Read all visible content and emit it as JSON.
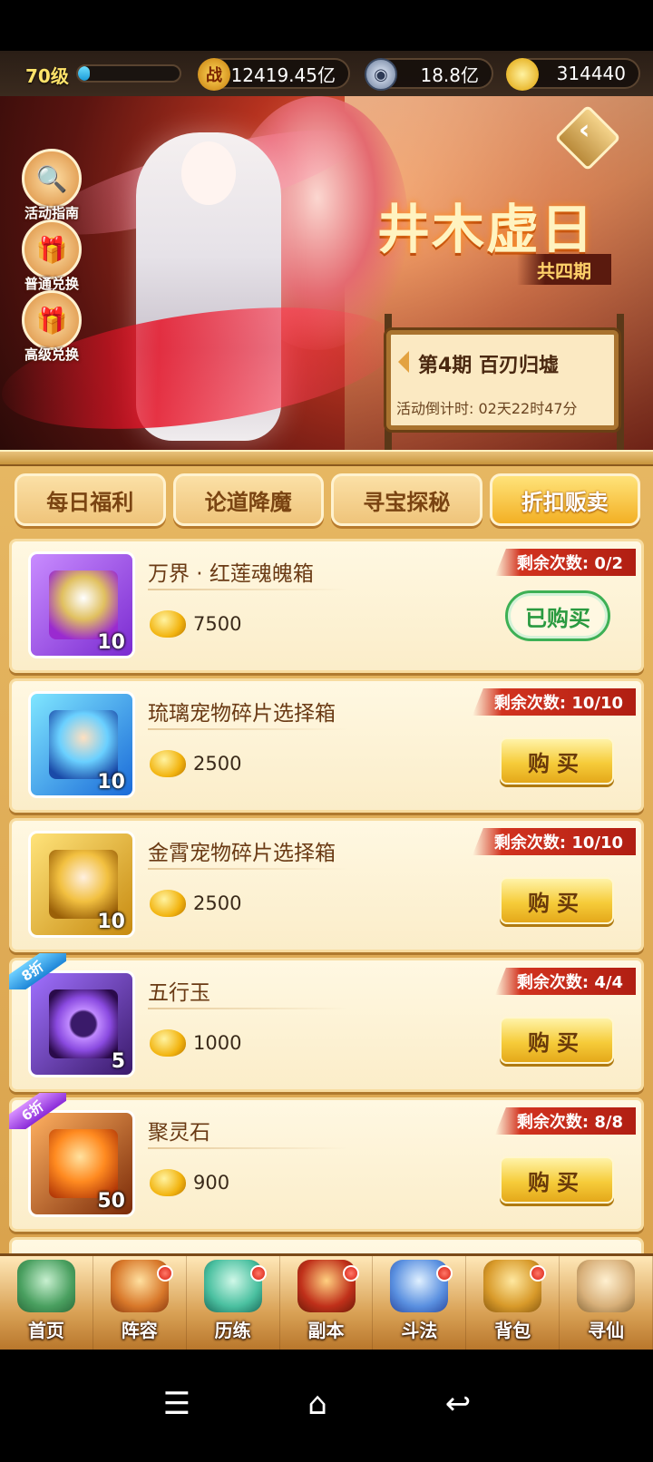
{
  "header": {
    "level": "70级",
    "level_progress": 0.12,
    "power_icon": "战",
    "power": "12419.45亿",
    "silver": "18.8亿",
    "gold": "314440"
  },
  "banner": {
    "title": "井木虚日",
    "period_total": "共四期",
    "period_title": "第4期  百刃归墟",
    "countdown": "活动倒计时: 02天22时47分",
    "side_buttons": [
      {
        "label": "活动指南",
        "icon": "magnifier-icon"
      },
      {
        "label": "普通兑换",
        "icon": "gift-box-icon"
      },
      {
        "label": "高级兑换",
        "icon": "gift-box-icon"
      }
    ]
  },
  "tabs": [
    "每日福利",
    "论道降魔",
    "寻宝探秘",
    "折扣贩卖"
  ],
  "active_tab": 3,
  "items": [
    {
      "name": "万界 · 红莲魂魄箱",
      "price": "7500",
      "count": "10",
      "remain": "剩余次数: 0/2",
      "button": "已购买",
      "bought": true,
      "discount": ""
    },
    {
      "name": "琉璃宠物碎片选择箱",
      "price": "2500",
      "count": "10",
      "remain": "剩余次数: 10/10",
      "button": "购买",
      "bought": false,
      "discount": ""
    },
    {
      "name": "金霄宠物碎片选择箱",
      "price": "2500",
      "count": "10",
      "remain": "剩余次数: 10/10",
      "button": "购买",
      "bought": false,
      "discount": ""
    },
    {
      "name": "五行玉",
      "price": "1000",
      "count": "5",
      "remain": "剩余次数: 4/4",
      "button": "购买",
      "bought": false,
      "discount": "8折"
    },
    {
      "name": "聚灵石",
      "price": "900",
      "count": "50",
      "remain": "剩余次数: 8/8",
      "button": "购买",
      "bought": false,
      "discount": "6折"
    }
  ],
  "nav": [
    {
      "label": "首页",
      "dot": false
    },
    {
      "label": "阵容",
      "dot": true
    },
    {
      "label": "历练",
      "dot": true
    },
    {
      "label": "副本",
      "dot": true
    },
    {
      "label": "斗法",
      "dot": true
    },
    {
      "label": "背包",
      "dot": true
    },
    {
      "label": "寻仙",
      "dot": false
    }
  ],
  "system_nav": {
    "menu": "☰",
    "home": "⌂",
    "back": "↩"
  }
}
